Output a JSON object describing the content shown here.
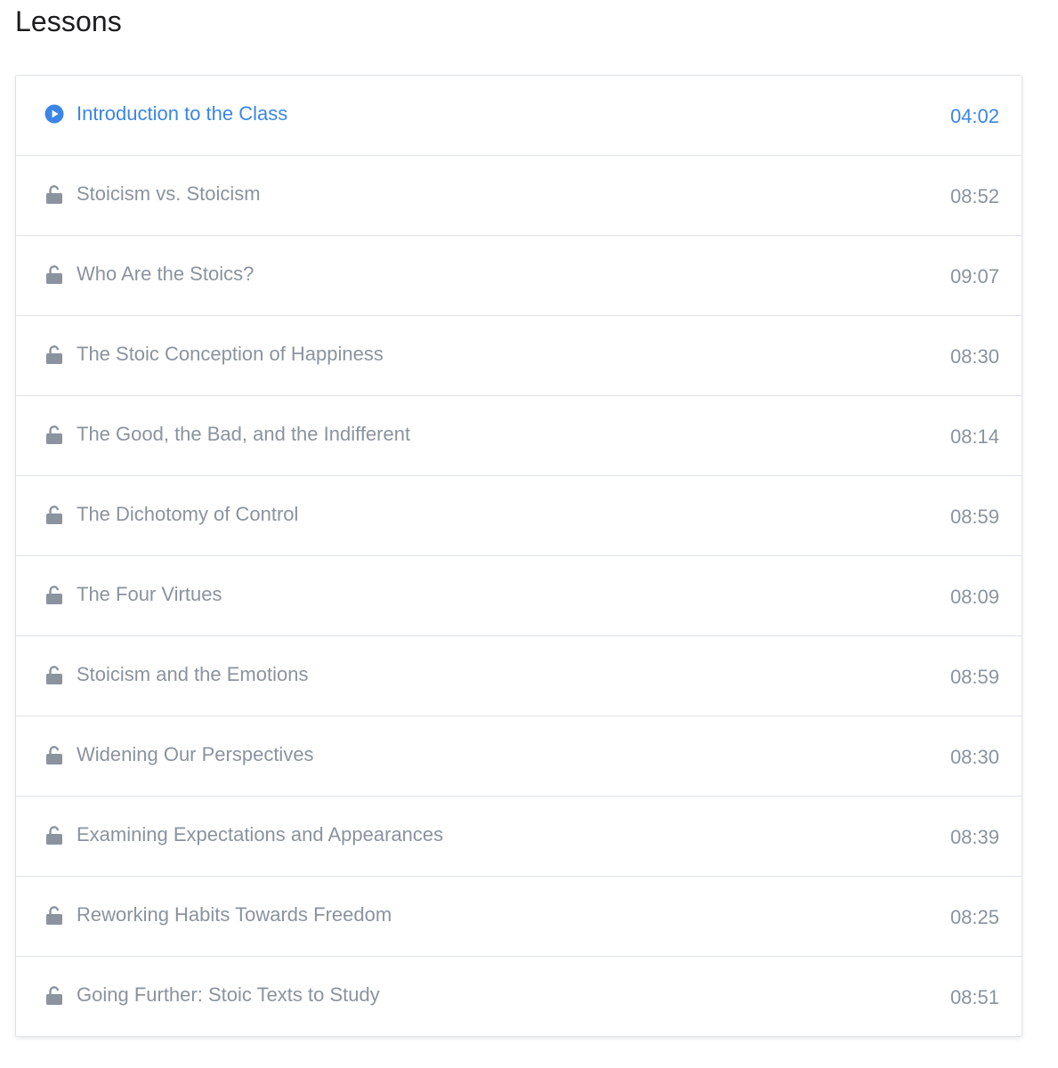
{
  "page": {
    "title": "Lessons"
  },
  "colors": {
    "active": "#3a86e6",
    "inactive": "#8a939e",
    "border": "#dfe3e8"
  },
  "lessons": [
    {
      "title": "Introduction to the Class",
      "duration": "04:02",
      "icon": "play-circle-icon",
      "active": true
    },
    {
      "title": "Stoicism vs. Stoicism",
      "duration": "08:52",
      "icon": "lock-icon",
      "active": false
    },
    {
      "title": "Who Are the Stoics?",
      "duration": "09:07",
      "icon": "lock-icon",
      "active": false
    },
    {
      "title": "The Stoic Conception of Happiness",
      "duration": "08:30",
      "icon": "lock-icon",
      "active": false
    },
    {
      "title": "The Good, the Bad, and the Indifferent",
      "duration": "08:14",
      "icon": "lock-icon",
      "active": false
    },
    {
      "title": "The Dichotomy of Control",
      "duration": "08:59",
      "icon": "lock-icon",
      "active": false
    },
    {
      "title": "The Four Virtues",
      "duration": "08:09",
      "icon": "lock-icon",
      "active": false
    },
    {
      "title": "Stoicism and the Emotions",
      "duration": "08:59",
      "icon": "lock-icon",
      "active": false
    },
    {
      "title": "Widening Our Perspectives",
      "duration": "08:30",
      "icon": "lock-icon",
      "active": false
    },
    {
      "title": "Examining Expectations and Appearances",
      "duration": "08:39",
      "icon": "lock-icon",
      "active": false
    },
    {
      "title": "Reworking Habits Towards Freedom",
      "duration": "08:25",
      "icon": "lock-icon",
      "active": false
    },
    {
      "title": "Going Further: Stoic Texts to Study",
      "duration": "08:51",
      "icon": "lock-icon",
      "active": false
    }
  ]
}
